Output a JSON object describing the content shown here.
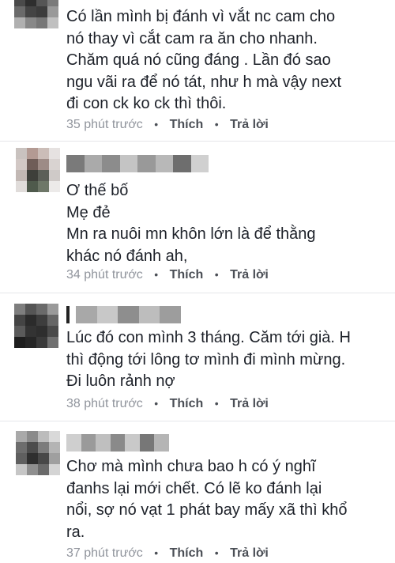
{
  "comments": [
    {
      "author": "",
      "text_lines": [
        "Có lần mình bị đánh vì vắt nc cam cho",
        "nó thay vì cắt cam ra ăn cho nhanh.",
        "Chăm quá nó cũng đáng . Lần đó sao",
        "ngu vãi ra để nó tát, như h mà vậy next",
        "đi con ck ko ck thì thôi."
      ],
      "time": "35 phút trước",
      "like_label": "Thích",
      "reply_label": "Trả lời"
    },
    {
      "author": "",
      "text_lines": [
        "Ơ thế bố",
        "Mẹ đẻ",
        "Mn ra nuôi mn khôn lớn là để thằng",
        "khác nó đánh ah,"
      ],
      "time": "34 phút trước",
      "like_label": "Thích",
      "reply_label": "Trả lời"
    },
    {
      "author": "",
      "text_lines": [
        "Lúc đó con mình 3 tháng. Căm tới già. H",
        "thì động tới lông tơ mình đi mình mừng.",
        "Đi luôn rảnh nợ"
      ],
      "time": "38 phút trước",
      "like_label": "Thích",
      "reply_label": "Trả lời"
    },
    {
      "author": "",
      "text_lines": [
        "Chơ mà mình chưa bao h có ý nghĩ",
        "đanhs lại mới chết. Có lẽ ko đánh lại",
        "nổi, sợ nó vạt 1 phát bay mấy xã thì khổ",
        "ra."
      ],
      "time": "37 phút trước",
      "like_label": "Thích",
      "reply_label": "Trả lời"
    }
  ],
  "separator": "•"
}
